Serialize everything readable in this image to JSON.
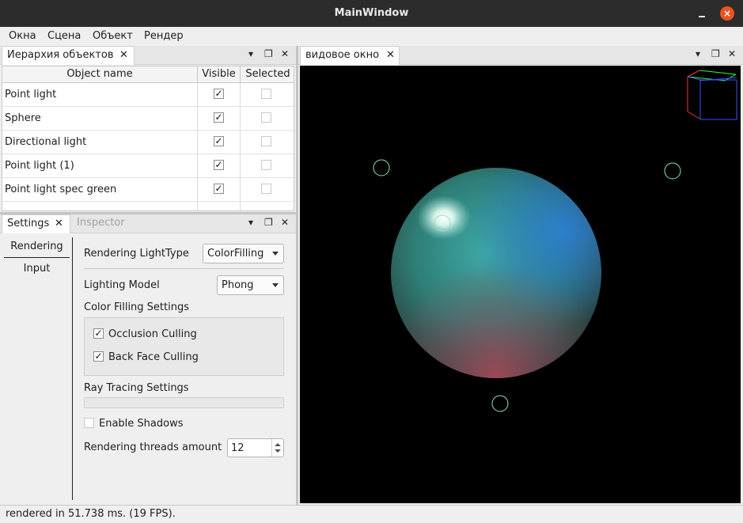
{
  "window": {
    "title": "MainWindow",
    "minimize": "–",
    "close": "×"
  },
  "menu": [
    "Окна",
    "Сцена",
    "Объект",
    "Рендер"
  ],
  "hierarchy": {
    "tab_label": "Иерархия объектов",
    "columns": [
      "Object name",
      "Visible",
      "Selected"
    ],
    "rows": [
      {
        "name": "Point light",
        "visible": true,
        "selected": false
      },
      {
        "name": "Sphere",
        "visible": true,
        "selected": false
      },
      {
        "name": "Directional light",
        "visible": true,
        "selected": false
      },
      {
        "name": "Point light (1)",
        "visible": true,
        "selected": false
      },
      {
        "name": "Point light spec green",
        "visible": true,
        "selected": false
      }
    ]
  },
  "viewport": {
    "tab_label": "видовое окно"
  },
  "settings_dock": {
    "tabs": [
      "Settings",
      "Inspector"
    ],
    "active_tab": "Settings",
    "side_tabs": [
      "Rendering",
      "Input"
    ],
    "rendering_light_type_label": "Rendering LightType",
    "rendering_light_type_value": "ColorFilling",
    "lighting_model_label": "Lighting Model",
    "lighting_model_value": "Phong",
    "color_filling_header": "Color Filling Settings",
    "occlusion_culling_label": "Occlusion Culling",
    "occlusion_culling_checked": true,
    "back_face_culling_label": "Back Face Culling",
    "back_face_culling_checked": true,
    "ray_tracing_header": "Ray Tracing Settings",
    "enable_shadows_label": "Enable Shadows",
    "enable_shadows_checked": false,
    "threads_label": "Rendering threads amount",
    "threads_value": "12"
  },
  "status": {
    "text": "rendered in 51.738 ms. (19 FPS)."
  },
  "colors": {
    "titlebar": "#2c2c2c",
    "close_button": "#e95420",
    "viewport_bg": "#000000"
  },
  "icons": {
    "dock_menu": "chevron-down-icon",
    "dock_float": "float-icon",
    "dock_close": "close-icon",
    "tab_close": "close-icon"
  }
}
